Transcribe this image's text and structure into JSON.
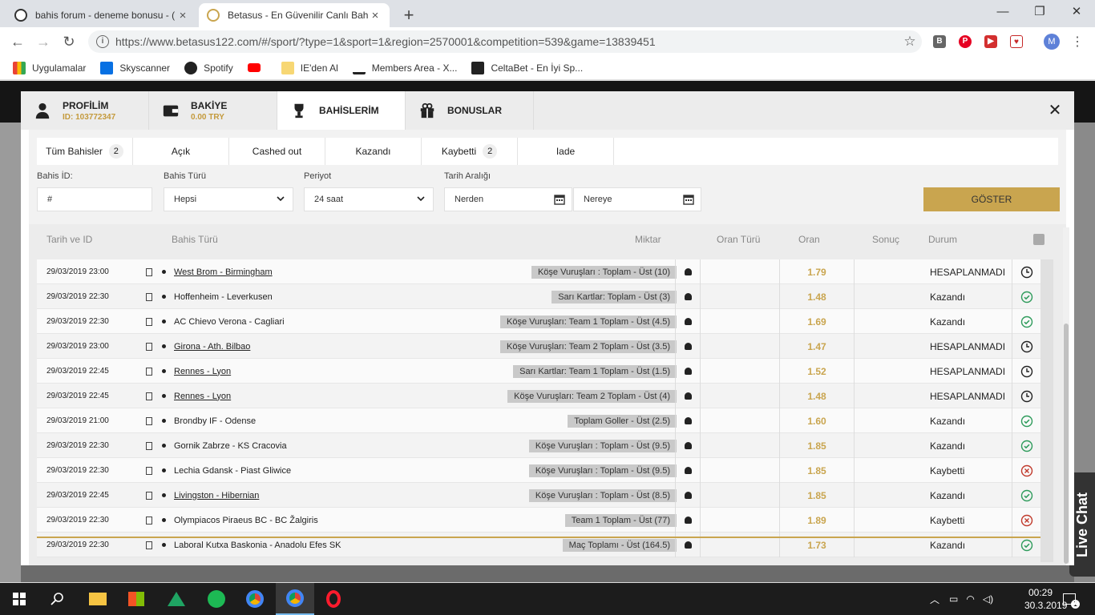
{
  "browser": {
    "tabs": [
      {
        "title": "bahis forum - deneme bonusu - (",
        "active": false
      },
      {
        "title": "Betasus - En Güvenilir Canlı Bahis",
        "active": true
      }
    ],
    "url": "https://www.betasus122.com/#/sport/?type=1&sport=1&region=2570001&competition=539&game=13839451",
    "profile_initial": "M",
    "bookmarks": [
      "Uygulamalar",
      "Skyscanner",
      "Spotify",
      "",
      "IE'den Al",
      "Members Area - X...",
      "CeltaBet - En İyi Sp..."
    ]
  },
  "modal": {
    "tabs": [
      {
        "label": "PROFİLİM",
        "sub": "ID: 103772347"
      },
      {
        "label": "BAKİYE",
        "sub": "0.00 TRY"
      },
      {
        "label": "BAHİSLERİM",
        "sub": ""
      },
      {
        "label": "BONUSLAR",
        "sub": ""
      }
    ],
    "filter_tabs": [
      {
        "label": "Tüm Bahisler",
        "count": "2"
      },
      {
        "label": "Açık",
        "count": ""
      },
      {
        "label": "Cashed out",
        "count": ""
      },
      {
        "label": "Kazandı",
        "count": ""
      },
      {
        "label": "Kaybetti",
        "count": "2"
      },
      {
        "label": "Iade",
        "count": ""
      }
    ],
    "filters": {
      "bahis_id_label": "Bahis İD:",
      "bahis_id_value": "#",
      "bahis_turu_label": "Bahis Türü",
      "bahis_turu_value": "Hepsi",
      "periyot_label": "Periyot",
      "periyot_value": "24 saat",
      "tarih_label": "Tarih Aralığı",
      "nerden": "Nerden",
      "nereye": "Nereye",
      "goster": "GÖSTER"
    },
    "table": {
      "headers": [
        "Tarih ve ID",
        "Bahis Türü",
        "Miktar",
        "Oran Türü",
        "Oran",
        "Sonuç",
        "Durum"
      ],
      "rows": [
        {
          "date": "29/03/2019 23:00",
          "event": "West Brom - Birmingham",
          "underline": true,
          "market": "Köşe Vuruşları : Toplam - Üst (10)",
          "odds": "1.79",
          "status": "HESAPLANMADI",
          "state": "pending"
        },
        {
          "date": "29/03/2019 22:30",
          "event": "Hoffenheim - Leverkusen",
          "underline": false,
          "market": "Sarı Kartlar: Toplam - Üst (3)",
          "odds": "1.48",
          "status": "Kazandı",
          "state": "won"
        },
        {
          "date": "29/03/2019 22:30",
          "event": "AC Chievo Verona - Cagliari",
          "underline": false,
          "market": "Köşe Vuruşları: Team 1 Toplam - Üst (4.5)",
          "odds": "1.69",
          "status": "Kazandı",
          "state": "won"
        },
        {
          "date": "29/03/2019 23:00",
          "event": "Girona - Ath. Bilbao",
          "underline": true,
          "market": "Köşe Vuruşları: Team 2 Toplam - Üst (3.5)",
          "odds": "1.47",
          "status": "HESAPLANMADI",
          "state": "pending"
        },
        {
          "date": "29/03/2019 22:45",
          "event": "Rennes - Lyon",
          "underline": true,
          "market": "Sarı Kartlar: Team 1 Toplam - Üst (1.5)",
          "odds": "1.52",
          "status": "HESAPLANMADI",
          "state": "pending"
        },
        {
          "date": "29/03/2019 22:45",
          "event": "Rennes - Lyon",
          "underline": true,
          "market": "Köşe Vuruşları: Team 2 Toplam - Üst (4)",
          "odds": "1.48",
          "status": "HESAPLANMADI",
          "state": "pending"
        },
        {
          "date": "29/03/2019 21:00",
          "event": "Brondby IF - Odense",
          "underline": false,
          "market": "Toplam Goller - Üst (2.5)",
          "odds": "1.60",
          "status": "Kazandı",
          "state": "won"
        },
        {
          "date": "29/03/2019 22:30",
          "event": "Gornik Zabrze - KS Cracovia",
          "underline": false,
          "market": "Köşe Vuruşları : Toplam - Üst (9.5)",
          "odds": "1.85",
          "status": "Kazandı",
          "state": "won"
        },
        {
          "date": "29/03/2019 22:30",
          "event": "Lechia Gdansk - Piast Gliwice",
          "underline": false,
          "market": "Köşe Vuruşları : Toplam - Üst (9.5)",
          "odds": "1.85",
          "status": "Kaybetti",
          "state": "lost"
        },
        {
          "date": "29/03/2019 22:45",
          "event": "Livingston - Hibernian",
          "underline": true,
          "market": "Köşe Vuruşları : Toplam - Üst (8.5)",
          "odds": "1.85",
          "status": "Kazandı",
          "state": "won"
        },
        {
          "date": "29/03/2019 22:30",
          "event": "Olympiacos Piraeus BC - BC Žalgiris",
          "underline": false,
          "market": "Team 1 Toplam - Üst (77)",
          "odds": "1.89",
          "status": "Kaybetti",
          "state": "lost"
        },
        {
          "date": "29/03/2019 22:30",
          "event": "Laboral Kutxa Baskonia - Anadolu Efes SK",
          "underline": false,
          "market": "Maç Toplamı - Üst (164.5)",
          "odds": "1.73",
          "status": "Kazandı",
          "state": "won"
        }
      ]
    }
  },
  "side_widget": "Live Chat",
  "taskbar": {
    "time": "00:29",
    "date": "30.3.2019",
    "notifications": "1"
  },
  "colors": {
    "gold": "#c9a54f",
    "won": "#2e9b5b",
    "lost": "#c0392b"
  }
}
